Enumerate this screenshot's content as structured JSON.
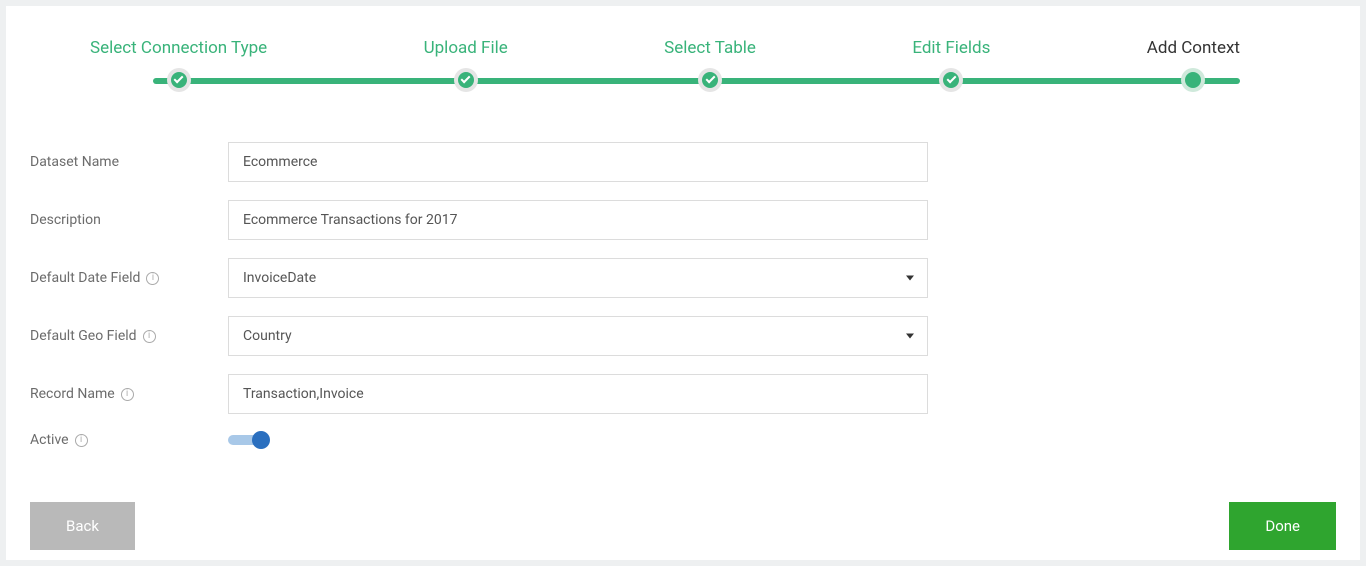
{
  "stepper": {
    "steps": [
      {
        "label": "Select Connection Type",
        "state": "done"
      },
      {
        "label": "Upload File",
        "state": "done"
      },
      {
        "label": "Select Table",
        "state": "done"
      },
      {
        "label": "Edit Fields",
        "state": "done"
      },
      {
        "label": "Add Context",
        "state": "current"
      }
    ]
  },
  "form": {
    "dataset_name": {
      "label": "Dataset Name",
      "value": "Ecommerce"
    },
    "description": {
      "label": "Description",
      "value": "Ecommerce Transactions for 2017"
    },
    "default_date_field": {
      "label": "Default Date Field",
      "value": "InvoiceDate"
    },
    "default_geo_field": {
      "label": "Default Geo Field",
      "value": "Country"
    },
    "record_name": {
      "label": "Record Name",
      "value": "Transaction,Invoice"
    },
    "active": {
      "label": "Active",
      "value": true
    }
  },
  "actions": {
    "back": "Back",
    "done": "Done"
  }
}
